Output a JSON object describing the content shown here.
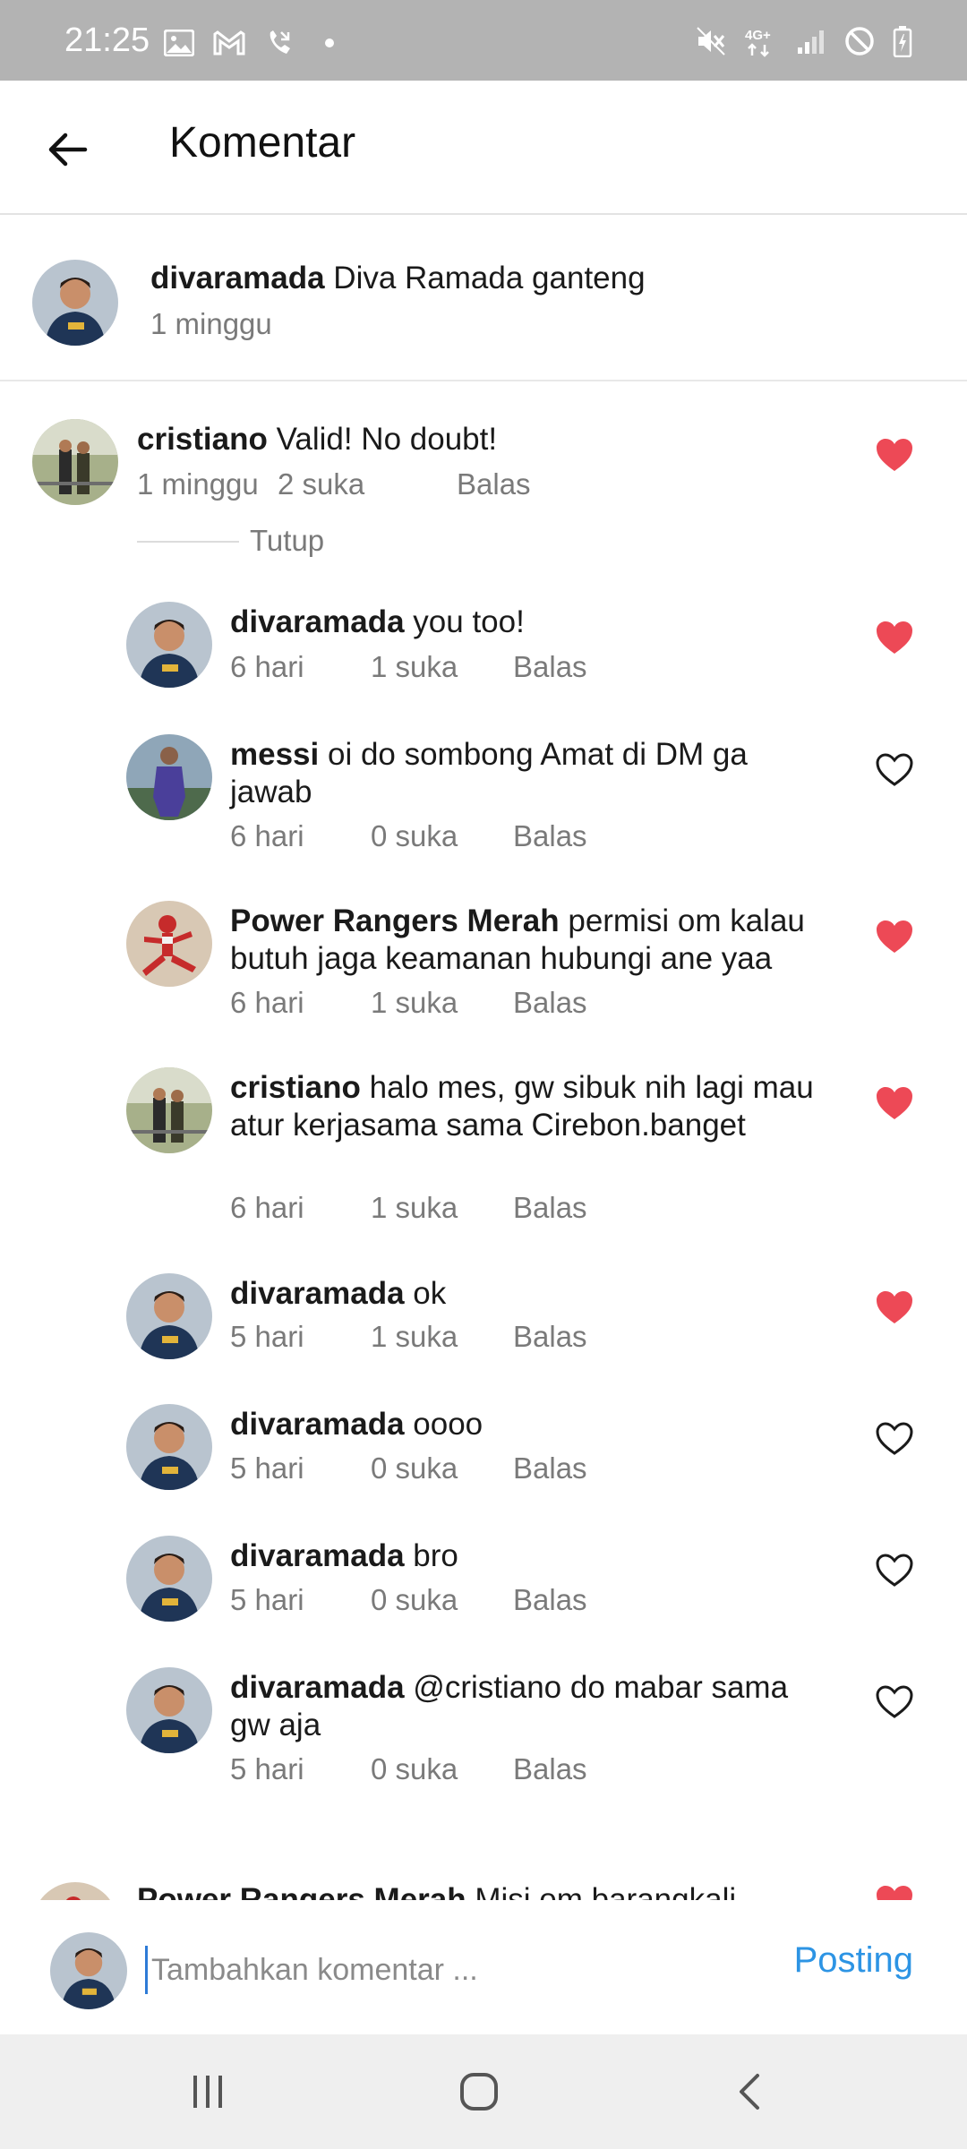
{
  "status_bar": {
    "time": "21:25",
    "left_icons": [
      "image-icon",
      "gmail-icon",
      "missed-call-icon",
      "dot-icon"
    ],
    "right_icons": [
      "mute-icon",
      "4g-icon",
      "signal-icon",
      "blocked-icon",
      "battery-icon"
    ],
    "network_label": "4G+"
  },
  "header": {
    "back_icon": "arrow-left-icon",
    "title": "Komentar"
  },
  "caption": {
    "username": "divaramada",
    "text": " Diva Ramada ganteng",
    "time": "1 minggu"
  },
  "comments": [
    {
      "username": "cristiano",
      "text": " Valid! No doubt!",
      "time": "1 minggu",
      "likes": "2 suka",
      "reply": "Balas",
      "liked": true
    }
  ],
  "collapse_label": "Tutup",
  "replies": [
    {
      "username": "divaramada",
      "text": " you too!",
      "time": "6 hari",
      "likes": "1 suka",
      "reply": "Balas",
      "liked": true
    },
    {
      "username": "messi",
      "text": " oi do sombong Amat di DM ga jawab",
      "time": "6 hari",
      "likes": "0 suka",
      "reply": "Balas",
      "liked": false
    },
    {
      "username": "Power Rangers Merah",
      "text": " permisi om kalau butuh jaga keamanan hubungi ane yaa",
      "time": "6 hari",
      "likes": "1 suka",
      "reply": "Balas",
      "liked": true
    },
    {
      "username": "cristiano",
      "text": " halo mes, gw sibuk nih lagi mau atur kerjasama sama Cirebon.banget",
      "time": "6 hari",
      "likes": "1 suka",
      "reply": "Balas",
      "liked": true
    },
    {
      "username": "divaramada",
      "text": " ok",
      "time": "5 hari",
      "likes": "1 suka",
      "reply": "Balas",
      "liked": true
    },
    {
      "username": "divaramada",
      "text": " oooo",
      "time": "5 hari",
      "likes": "0 suka",
      "reply": "Balas",
      "liked": false
    },
    {
      "username": "divaramada",
      "text": " bro",
      "time": "5 hari",
      "likes": "0 suka",
      "reply": "Balas",
      "liked": false
    },
    {
      "username": "divaramada",
      "text": " @cristiano do mabar sama gw aja",
      "time": "5 hari",
      "likes": "0 suka",
      "reply": "Balas",
      "liked": false
    }
  ],
  "partial_comment": {
    "username": "Power Rangers Merah",
    "text": " Misi om barangkali"
  },
  "input": {
    "placeholder": "Tambahkan komentar ...",
    "post_label": "Posting"
  },
  "nav": {
    "icons": [
      "recent-apps-icon",
      "home-icon",
      "back-icon"
    ]
  },
  "colors": {
    "like_red": "#ed4956",
    "link_blue": "#2d94e4",
    "meta_gray": "#7a7a7a",
    "status_bar_bg": "#b3b3b3",
    "nav_bar_bg": "#efefef"
  }
}
